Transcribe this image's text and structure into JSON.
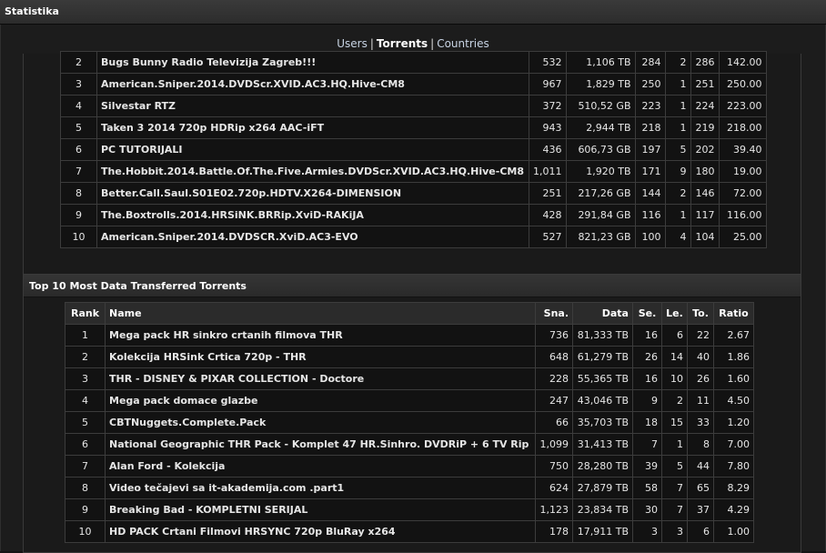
{
  "header": {
    "title": "Statistika"
  },
  "nav": {
    "items": [
      {
        "label": "Users"
      },
      {
        "label": "Torrents"
      },
      {
        "label": "Countries"
      }
    ],
    "separator": "|",
    "active": "Torrents"
  },
  "top_table": {
    "rows": [
      {
        "rank": "2",
        "name": "Bugs Bunny Radio Televizija Zagreb!!!",
        "sna": "532",
        "data": "1,106 TB",
        "se": "284",
        "le": "2",
        "to": "286",
        "ratio": "142.00"
      },
      {
        "rank": "3",
        "name": "American.Sniper.2014.DVDScr.XVID.AC3.HQ.Hive-CM8",
        "sna": "967",
        "data": "1,829 TB",
        "se": "250",
        "le": "1",
        "to": "251",
        "ratio": "250.00"
      },
      {
        "rank": "4",
        "name": "Silvestar RTZ",
        "sna": "372",
        "data": "510,52 GB",
        "se": "223",
        "le": "1",
        "to": "224",
        "ratio": "223.00"
      },
      {
        "rank": "5",
        "name": "Taken 3 2014 720p HDRip x264 AAC-iFT",
        "sna": "943",
        "data": "2,944 TB",
        "se": "218",
        "le": "1",
        "to": "219",
        "ratio": "218.00"
      },
      {
        "rank": "6",
        "name": "PC TUTORIJALI",
        "sna": "436",
        "data": "606,73 GB",
        "se": "197",
        "le": "5",
        "to": "202",
        "ratio": "39.40"
      },
      {
        "rank": "7",
        "name": "The.Hobbit.2014.Battle.Of.The.Five.Armies.DVDScr.XVID.AC3.HQ.Hive-CM8",
        "sna": "1,011",
        "data": "1,920 TB",
        "se": "171",
        "le": "9",
        "to": "180",
        "ratio": "19.00"
      },
      {
        "rank": "8",
        "name": "Better.Call.Saul.S01E02.720p.HDTV.X264-DIMENSION",
        "sna": "251",
        "data": "217,26 GB",
        "se": "144",
        "le": "2",
        "to": "146",
        "ratio": "72.00"
      },
      {
        "rank": "9",
        "name": "The.Boxtrolls.2014.HRSiNK.BRRip.XviD-RAKiJA",
        "sna": "428",
        "data": "291,84 GB",
        "se": "116",
        "le": "1",
        "to": "117",
        "ratio": "116.00"
      },
      {
        "rank": "10",
        "name": "American.Sniper.2014.DVDSCR.XviD.AC3-EVO",
        "sna": "527",
        "data": "821,23 GB",
        "se": "100",
        "le": "4",
        "to": "104",
        "ratio": "25.00"
      }
    ]
  },
  "data_panel": {
    "title": "Top 10 Most Data Transferred Torrents",
    "columns": {
      "rank": "Rank",
      "name": "Name",
      "sna": "Sna.",
      "data": "Data",
      "se": "Se.",
      "le": "Le.",
      "to": "To.",
      "ratio": "Ratio"
    },
    "rows": [
      {
        "rank": "1",
        "name": "Mega pack HR sinkro crtanih filmova THR",
        "sna": "736",
        "data": "81,333 TB",
        "se": "16",
        "le": "6",
        "to": "22",
        "ratio": "2.67"
      },
      {
        "rank": "2",
        "name": "Kolekcija HRSink Crtica 720p - THR",
        "sna": "648",
        "data": "61,279 TB",
        "se": "26",
        "le": "14",
        "to": "40",
        "ratio": "1.86"
      },
      {
        "rank": "3",
        "name": "THR - DISNEY & PIXAR COLLECTION - Doctore",
        "sna": "228",
        "data": "55,365 TB",
        "se": "16",
        "le": "10",
        "to": "26",
        "ratio": "1.60"
      },
      {
        "rank": "4",
        "name": "Mega pack domace glazbe",
        "sna": "247",
        "data": "43,046 TB",
        "se": "9",
        "le": "2",
        "to": "11",
        "ratio": "4.50"
      },
      {
        "rank": "5",
        "name": "CBTNuggets.Complete.Pack",
        "sna": "66",
        "data": "35,703 TB",
        "se": "18",
        "le": "15",
        "to": "33",
        "ratio": "1.20"
      },
      {
        "rank": "6",
        "name": "National Geographic THR Pack - Komplet 47 HR.Sinhro. DVDRiP + 6 TV Rip",
        "sna": "1,099",
        "data": "31,413 TB",
        "se": "7",
        "le": "1",
        "to": "8",
        "ratio": "7.00"
      },
      {
        "rank": "7",
        "name": "Alan Ford - Kolekcija",
        "sna": "750",
        "data": "28,280 TB",
        "se": "39",
        "le": "5",
        "to": "44",
        "ratio": "7.80"
      },
      {
        "rank": "8",
        "name": "Video tečajevi sa it-akademija.com .part1",
        "sna": "624",
        "data": "27,879 TB",
        "se": "58",
        "le": "7",
        "to": "65",
        "ratio": "8.29"
      },
      {
        "rank": "9",
        "name": "Breaking Bad - KOMPLETNI SERIJAL",
        "sna": "1,123",
        "data": "23,834 TB",
        "se": "30",
        "le": "7",
        "to": "37",
        "ratio": "4.29"
      },
      {
        "rank": "10",
        "name": "HD PACK Crtani Filmovi HRSYNC 720p BluRay x264",
        "sna": "178",
        "data": "17,911 TB",
        "se": "3",
        "le": "3",
        "to": "6",
        "ratio": "1.00"
      }
    ]
  }
}
